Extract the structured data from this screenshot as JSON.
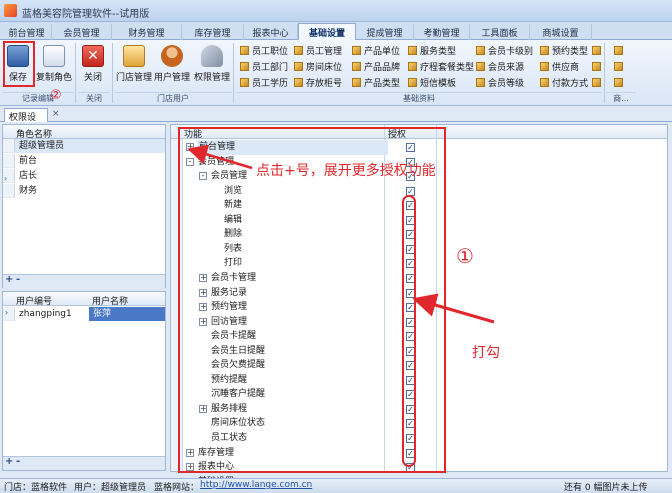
{
  "window": {
    "title": "蓝格美容院管理软件--试用版"
  },
  "menu_tabs": [
    "前台管理",
    "会员管理",
    "财务管理",
    "库存管理",
    "报表中心",
    "基础设置",
    "提成管理",
    "考勤管理",
    "工具面板",
    "商城设置"
  ],
  "ribbon": {
    "big_buttons": {
      "save": "保存",
      "copy_role": "复制角色",
      "close": "关闭",
      "store_mgmt": "门店管理",
      "user_mgmt": "用户管理",
      "perm_mgmt": "权限管理"
    },
    "group_captions": {
      "record_edit": "记录编辑",
      "close": "关闭",
      "store_user": "门店用户",
      "basic_data": "基础资料",
      "more": "商..."
    },
    "small_buttons": [
      [
        "员工职位",
        "员工管理",
        "产品单位",
        "服务类型",
        "会员卡级别",
        "预约类型"
      ],
      [
        "员工部门",
        "房间床位",
        "产品品牌",
        "疗程套餐类型",
        "会员来源",
        "供应商"
      ],
      [
        "员工学历",
        "存放柜号",
        "产品类型",
        "短信模板",
        "会员等级",
        "付款方式"
      ]
    ]
  },
  "doc_tab": {
    "label": "权限设定",
    "close": "×"
  },
  "roles_panel": {
    "header": "角色名称",
    "rows": [
      "超级管理员",
      "前台",
      "店长",
      "财务"
    ],
    "footer_add": "+",
    "footer_remove": "-"
  },
  "users_panel": {
    "headers": [
      "用户编号",
      "用户名称"
    ],
    "rows": [
      {
        "id": "zhangping1",
        "name": "张萍"
      }
    ],
    "footer_add": "+",
    "footer_remove": "-"
  },
  "tree_panel": {
    "headers": {
      "function": "功能",
      "auth": "授权"
    },
    "rows": [
      {
        "label": "前台管理",
        "level": 0,
        "expander": "+",
        "checked": true
      },
      {
        "label": "会员管理",
        "level": 0,
        "expander": "-",
        "checked": true
      },
      {
        "label": "会员管理",
        "level": 1,
        "expander": "-",
        "checked": true
      },
      {
        "label": "浏览",
        "level": 2,
        "expander": "",
        "checked": true
      },
      {
        "label": "新建",
        "level": 2,
        "expander": "",
        "checked": true
      },
      {
        "label": "编辑",
        "level": 2,
        "expander": "",
        "checked": true
      },
      {
        "label": "删除",
        "level": 2,
        "expander": "",
        "checked": true
      },
      {
        "label": "列表",
        "level": 2,
        "expander": "",
        "checked": true
      },
      {
        "label": "打印",
        "level": 2,
        "expander": "",
        "checked": true
      },
      {
        "label": "会员卡管理",
        "level": 1,
        "expander": "+",
        "checked": true
      },
      {
        "label": "服务记录",
        "level": 1,
        "expander": "+",
        "checked": true
      },
      {
        "label": "预约管理",
        "level": 1,
        "expander": "+",
        "checked": true
      },
      {
        "label": "回访管理",
        "level": 1,
        "expander": "+",
        "checked": true
      },
      {
        "label": "会员卡提醒",
        "level": 1,
        "expander": "",
        "checked": true
      },
      {
        "label": "会员生日提醒",
        "level": 1,
        "expander": "",
        "checked": true
      },
      {
        "label": "会员欠费提醒",
        "level": 1,
        "expander": "",
        "checked": true
      },
      {
        "label": "预约提醒",
        "level": 1,
        "expander": "",
        "checked": true
      },
      {
        "label": "沉睡客户提醒",
        "level": 1,
        "expander": "",
        "checked": true
      },
      {
        "label": "服务排程",
        "level": 1,
        "expander": "+",
        "checked": true
      },
      {
        "label": "房间床位状态",
        "level": 1,
        "expander": "",
        "checked": true
      },
      {
        "label": "员工状态",
        "level": 1,
        "expander": "",
        "checked": true
      },
      {
        "label": "库存管理",
        "level": 0,
        "expander": "+",
        "checked": true
      },
      {
        "label": "报表中心",
        "level": 0,
        "expander": "+",
        "checked": true
      },
      {
        "label": "基础设置",
        "level": 0,
        "expander": "+",
        "checked": true
      }
    ]
  },
  "annotations": {
    "hint_expand": "点击+号，展开更多授权功能",
    "hint_check": "打勾",
    "circle_1": "①",
    "circle_2": "②"
  },
  "status_bar": {
    "store": "门店：蓝格软件",
    "user": "用户：超级管理员",
    "website_label": "蓝格网站：",
    "website": "http://www.lange.com.cn",
    "upload": "还有 0 幅图片未上传"
  },
  "colors": {
    "annotation_red": "#e0282c",
    "accent_blue": "#2c5a98"
  }
}
